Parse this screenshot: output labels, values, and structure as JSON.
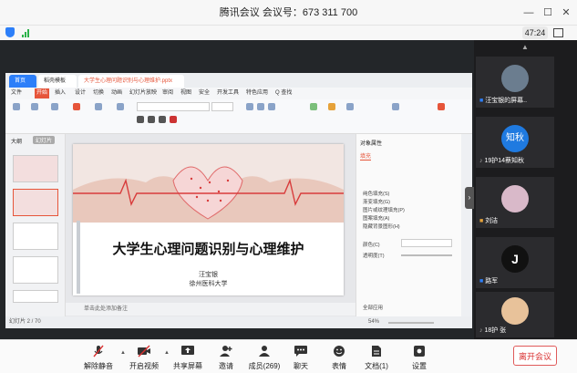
{
  "window": {
    "title": "腾讯会议 会议号：673 311 700",
    "timer": "47:24"
  },
  "ppt": {
    "tabs": [
      "首页",
      "稻壳模板",
      "大学生心理问题识别与心理维护.pptx"
    ],
    "menu": [
      "文件",
      "开始",
      "插入",
      "设计",
      "切换",
      "动画",
      "幻灯片放映",
      "审阅",
      "视图",
      "安全",
      "开发工具",
      "特色应用",
      "Q 查找"
    ],
    "side_tabs": [
      "大纲",
      "幻灯片"
    ],
    "notes_placeholder": "单击此处添加备注",
    "status": "幻灯片 2 / 70",
    "zoom": "54%",
    "right_panel_title": "对象属性",
    "right_panel_tab": "填充",
    "right_options": [
      "纯色填充(S)",
      "渐变填充(G)",
      "图片或纹理填充(P)",
      "图案填充(A)",
      "隐藏背景图形(H)"
    ],
    "right_fields": [
      "颜色(C)",
      "透明度(T)"
    ],
    "right_footer": "全部应用"
  },
  "slide": {
    "title": "大学生心理问题识别与心理维护",
    "author": "汪宝银",
    "organization": "徐州医科大学"
  },
  "participants": [
    {
      "name": "汪宝银的屏幕..",
      "avatar_color": "#6b7d8f"
    },
    {
      "name": "19护14蔡知秋",
      "avatar_color": "#1f7ae0",
      "avatar_text": "知秋"
    },
    {
      "name": "刘洁",
      "avatar_color": "#d9b9c9"
    },
    {
      "name": "路军",
      "avatar_color": "#111111"
    },
    {
      "name": "18护 张",
      "avatar_color": "#e8c29a"
    }
  ],
  "toolbar": [
    {
      "label": "解除静音",
      "icon": "mic-muted-icon"
    },
    {
      "label": "开启视频",
      "icon": "video-off-icon"
    },
    {
      "label": "共享屏幕",
      "icon": "share-screen-icon"
    },
    {
      "label": "邀请",
      "icon": "invite-icon"
    },
    {
      "label": "成员(269)",
      "icon": "members-icon"
    },
    {
      "label": "聊天",
      "icon": "chat-icon"
    },
    {
      "label": "表情",
      "icon": "emoji-icon"
    },
    {
      "label": "文档(1)",
      "icon": "document-icon"
    },
    {
      "label": "设置",
      "icon": "settings-icon"
    }
  ],
  "leave_label": "离开会议",
  "colors": {
    "accent": "#2d7ff9",
    "leave": "#d93030",
    "ppt_tab": "#e6553a"
  }
}
